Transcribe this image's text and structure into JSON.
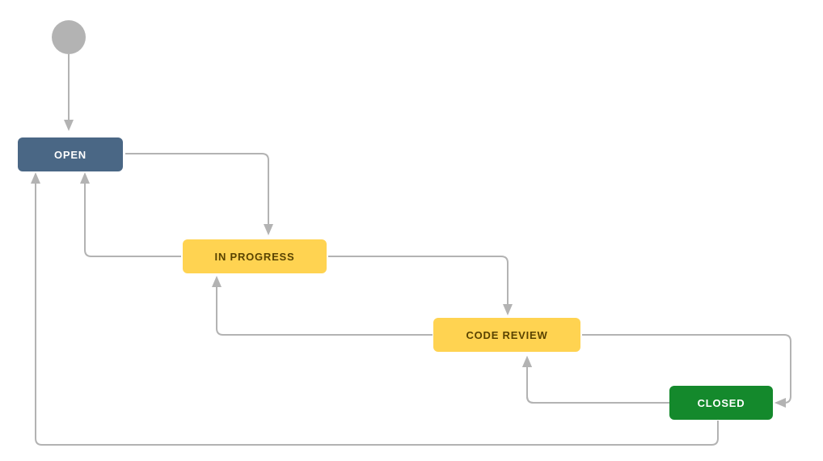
{
  "workflow": {
    "start": {
      "label": ""
    },
    "states": {
      "open": {
        "label": "OPEN"
      },
      "in_progress": {
        "label": "IN PROGRESS"
      },
      "code_review": {
        "label": "CODE REVIEW"
      },
      "closed": {
        "label": "CLOSED"
      }
    },
    "transitions": [
      {
        "from": "start",
        "to": "open"
      },
      {
        "from": "open",
        "to": "in_progress"
      },
      {
        "from": "in_progress",
        "to": "open"
      },
      {
        "from": "in_progress",
        "to": "code_review"
      },
      {
        "from": "code_review",
        "to": "in_progress"
      },
      {
        "from": "code_review",
        "to": "closed"
      },
      {
        "from": "closed",
        "to": "code_review"
      },
      {
        "from": "closed",
        "to": "open"
      }
    ],
    "colors": {
      "open": "#4a6785",
      "yellow": "#ffd351",
      "closed": "#14892c",
      "edge": "#b3b3b3"
    }
  }
}
